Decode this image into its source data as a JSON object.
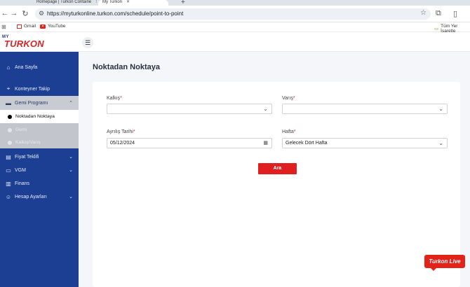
{
  "browser": {
    "tabs": [
      {
        "title": "Homepage | Turkon Containe"
      },
      {
        "title": "My Turkon"
      }
    ],
    "url": "https://myturkonline.turkon.com/schedule/point-to-point",
    "bookmarks": [
      "Gmail",
      "YouTube"
    ],
    "all_bookmarks": "Tüm Yer İşaretle"
  },
  "logo": {
    "small": "MY",
    "main": "TURKON"
  },
  "sidebar": {
    "items": [
      {
        "label": "Ana Sayfa",
        "icon": "home-icon"
      },
      {
        "label": "Konteyner Takip",
        "icon": "location-pin-icon"
      },
      {
        "label": "Gemi Programı",
        "icon": "ship-icon"
      },
      {
        "label": "Fiyat Teklifi",
        "icon": "document-icon"
      },
      {
        "label": "VGM",
        "icon": "card-icon"
      },
      {
        "label": "Finans",
        "icon": "chart-icon"
      },
      {
        "label": "Hesap Ayarları",
        "icon": "user-icon"
      }
    ],
    "subitems": [
      {
        "label": "Noktadan Noktaya"
      },
      {
        "label": "Gemi"
      },
      {
        "label": "Kalkış/Varış"
      }
    ]
  },
  "page": {
    "title": "Noktadan Noktaya",
    "departure_label": "Kalkış",
    "arrival_label": "Varış",
    "date_label": "Ayrılış Tarihi",
    "date_value": "05/12/2024",
    "week_label": "Hafta",
    "week_value": "Gelecek Dört Hafta",
    "search_button": "Ara",
    "required_mark": "*"
  },
  "live_chat": "Turkon Live"
}
